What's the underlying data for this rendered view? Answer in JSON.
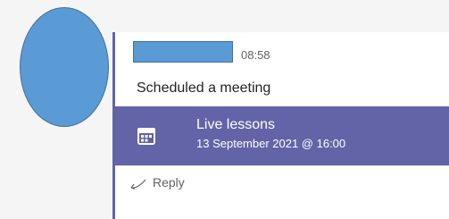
{
  "post": {
    "sender_name": "",
    "time": "08:58",
    "message": "Scheduled a meeting"
  },
  "meeting": {
    "icon": "calendar-icon",
    "title": "Live lessons",
    "date": "13 September 2021 @ 16:00"
  },
  "reply": {
    "icon": "reply-icon",
    "label": "Reply"
  },
  "colors": {
    "accent": "#6264a7",
    "avatar_fill": "#5b9bd5",
    "text_muted": "#616161"
  }
}
